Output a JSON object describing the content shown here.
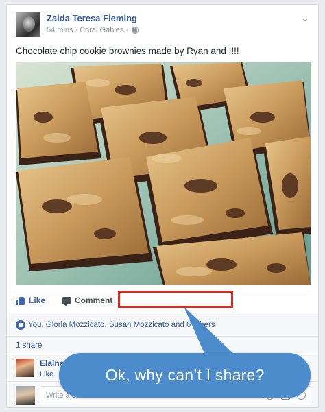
{
  "post": {
    "author": "Zaida Teresa Fleming",
    "time": "54 mins",
    "location": "Coral Gables",
    "text": "Chocolate chip cookie brownies made by Ryan and I!!!",
    "photo_icon": "brownies-photo"
  },
  "actions": {
    "like_label": "Like",
    "comment_label": "Comment"
  },
  "reactions": {
    "text": "You, Gloria Mozzicato, Susan Mozzicato and 6 others"
  },
  "shares": {
    "text": "1 share"
  },
  "comment": {
    "author": "Elaine J",
    "like_label": "Like"
  },
  "composer": {
    "placeholder": "Write a comment..."
  },
  "callout": {
    "text": "Ok, why can’t I share?"
  },
  "colors": {
    "link": "#365899",
    "highlight": "#e2281a",
    "callout": "#4c8ccd"
  }
}
